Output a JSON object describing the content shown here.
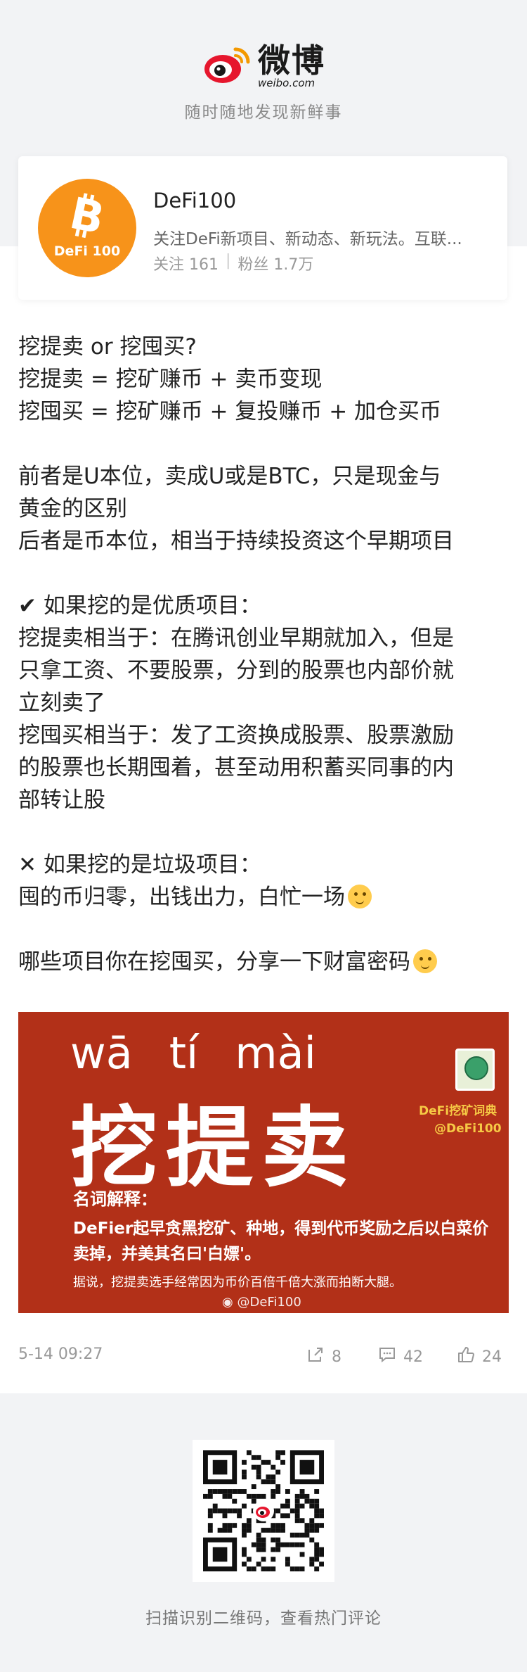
{
  "header": {
    "logo_cn": "微博",
    "logo_en": "weibo.com",
    "tagline": "随时随地发现新鲜事"
  },
  "profile": {
    "avatar_text": "DeFi 100",
    "name": "DeFi100",
    "description": "关注DeFi新项目、新动态、新玩法。互联...",
    "following": "关注 161",
    "followers": "粉丝 1.7万"
  },
  "post": {
    "lines": [
      "挖提卖 or 挖囤买?",
      "挖提卖 = 挖矿赚币 + 卖币变现",
      "挖囤买 = 挖矿赚币 + 复投赚币 + 加仓买币",
      "",
      "前者是U本位，卖成U或是BTC，只是现金与",
      "黄金的区别",
      "后者是币本位，相当于持续投资这个早期项目",
      "",
      "✔ 如果挖的是优质项目：",
      "挖提卖相当于：在腾讯创业早期就加入，但是",
      "只拿工资、不要股票，分到的股票也内部价就",
      "立刻卖了",
      "挖囤买相当于：发了工资换成股票、股票激励",
      "的股票也长期囤着，甚至动用积蓄买同事的内",
      "部转让股",
      "",
      "✕ 如果挖的是垃圾项目："
    ],
    "line_emoji1": "囤的币归零，出钱出力，白忙一场",
    "blank": "",
    "line_emoji2": "哪些项目你在挖囤买，分享一下财富密码"
  },
  "promo": {
    "pinyin": [
      "wā",
      "tí",
      "mài"
    ],
    "headword": "挖提卖",
    "brand_cn": "DeFi挖矿词典",
    "brand_handle": "@DeFi100",
    "def_title": "名词解释：",
    "def_body": "DeFier起早贪黑挖矿、种地，得到代币奖励之后以白菜价卖掉，并美其名曰'白嫖'。",
    "def_note": "据说，挖提卖选手经常因为币价百倍千倍大涨而拍断大腿。",
    "watermark": "@DeFi100"
  },
  "meta": {
    "date": "5-14 09:27",
    "shares": "8",
    "comments": "42",
    "likes": "24"
  },
  "footer": {
    "scan_hint": "扫描识别二维码，查看热门评论"
  },
  "colors": {
    "page_bg": "#f2f3f5",
    "promo_bg": "#b23018",
    "bitcoin_orange": "#f7931a",
    "weibo_red": "#e6162d",
    "brand_yellow": "#f6c945"
  }
}
